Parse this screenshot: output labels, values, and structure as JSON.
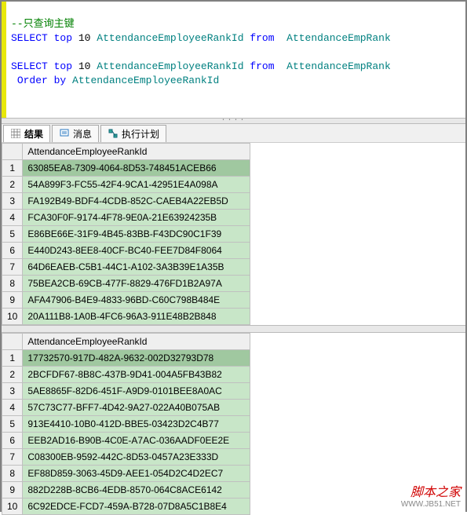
{
  "editor": {
    "comment": "--只查询主键",
    "q1": {
      "kw1": "SELECT",
      "kw2": "top",
      "num": "10",
      "col": "AttendanceEmployeeRankId",
      "kw3": "from",
      "tbl": "AttendanceEmpRank"
    },
    "q2": {
      "kw1": "SELECT",
      "kw2": "top",
      "num": "10",
      "col": "AttendanceEmployeeRankId",
      "kw3": "from",
      "tbl": "AttendanceEmpRank",
      "kw4": "Order by",
      "col2": "AttendanceEmployeeRankId"
    }
  },
  "tabs": {
    "results": "结果",
    "messages": "消息",
    "plan": "执行计划"
  },
  "grid1": {
    "header": "AttendanceEmployeeRankId",
    "rows": [
      "63085EA8-7309-4064-8D53-748451ACEB66",
      "54A899F3-FC55-42F4-9CA1-42951E4A098A",
      "FA192B49-BDF4-4CDB-852C-CAEB4A22EB5D",
      "FCA30F0F-9174-4F78-9E0A-21E63924235B",
      "E86BE66E-31F9-4B45-83BB-F43DC90C1F39",
      "E440D243-8EE8-40CF-BC40-FEE7D84F8064",
      "64D6EAEB-C5B1-44C1-A102-3A3B39E1A35B",
      "75BEA2CB-69CB-477F-8829-476FD1B2A97A",
      "AFA47906-B4E9-4833-96BD-C60C798B484E",
      "20A111B8-1A0B-4FC6-96A3-911E48B2B848"
    ]
  },
  "grid2": {
    "header": "AttendanceEmployeeRankId",
    "rows": [
      "17732570-917D-482A-9632-002D32793D78",
      "2BCFDF67-8B8C-437B-9D41-004A5FB43B82",
      "5AE8865F-82D6-451F-A9D9-0101BEE8A0AC",
      "57C73C77-BFF7-4D42-9A27-022A40B075AB",
      "913E4410-10B0-412D-BBE5-03423D2C4B77",
      "EEB2AD16-B90B-4C0E-A7AC-036AADF0EE2E",
      "C08300EB-9592-442C-8D53-0457A23E333D",
      "EF88D859-3063-45D9-AEE1-054D2C4D2EC7",
      "882D228B-8CB6-4EDB-8570-064C8ACE6142",
      "6C92EDCE-FCD7-459A-B728-07D8A5C1B8E4"
    ]
  },
  "watermark": {
    "line1": "脚本之家",
    "line2": "WWW.JB51.NET"
  }
}
